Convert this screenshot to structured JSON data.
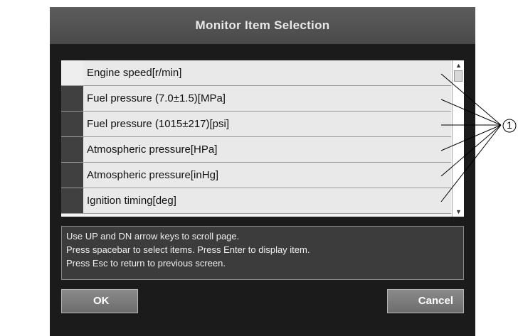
{
  "dialog": {
    "title": "Monitor Item Selection",
    "items": [
      {
        "label": "Engine speed[r/min]",
        "selected": false
      },
      {
        "label": "Fuel pressure (7.0±1.5)[MPa]",
        "selected": true
      },
      {
        "label": "Fuel pressure (1015±217)[psi]",
        "selected": true
      },
      {
        "label": "Atmospheric pressure[HPa]",
        "selected": true
      },
      {
        "label": "Atmospheric pressure[inHg]",
        "selected": true
      },
      {
        "label": "Ignition timing[deg]",
        "selected": true
      }
    ],
    "help_lines": [
      "Use UP and DN arrow keys to scroll page.",
      "Press spacebar to select items. Press Enter to display item.",
      "Press Esc to return to previous screen."
    ],
    "ok_label": "OK",
    "cancel_label": "Cancel"
  },
  "callout": {
    "number": "1",
    "icon": "circled-number"
  },
  "colors": {
    "titlebar": "#505050",
    "dialog_bg": "#1b1b1b",
    "selected_box": "#404040",
    "row_bg": "#e9e9e9"
  }
}
